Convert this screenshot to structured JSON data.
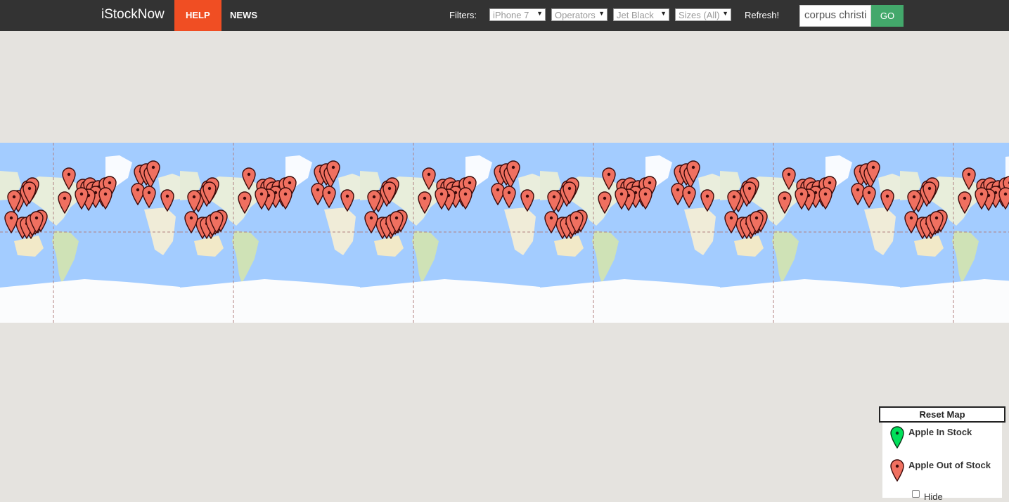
{
  "nav": {
    "brand": "iStockNow",
    "help": "HELP",
    "news": "NEWS",
    "help_color": "#f04e23"
  },
  "filters": {
    "label": "Filters:",
    "model": "iPhone 7",
    "operators": "Operators",
    "color": "Jet Black",
    "sizes": "Sizes (All)",
    "refresh": "Refresh!"
  },
  "search": {
    "value": "corpus christi",
    "go": "GO",
    "go_color": "#43a86b"
  },
  "legend": {
    "reset": "Reset Map",
    "in_stock": "Apple In Stock",
    "out_of_stock": "Apple Out of Stock",
    "hide": "Hide",
    "hide_checked": false,
    "in_stock_color": "#00e05a",
    "out_stock_color": "#f07060"
  },
  "icons": {
    "marker_in": "map-marker-green-icon",
    "marker_out": "map-marker-red-icon",
    "arrow": "dropdown-arrow-icon"
  },
  "colors": {
    "ocean": "#a3ccff",
    "land": "#f2efe9",
    "nav": "#333333",
    "page_bg": "#e5e3df"
  }
}
